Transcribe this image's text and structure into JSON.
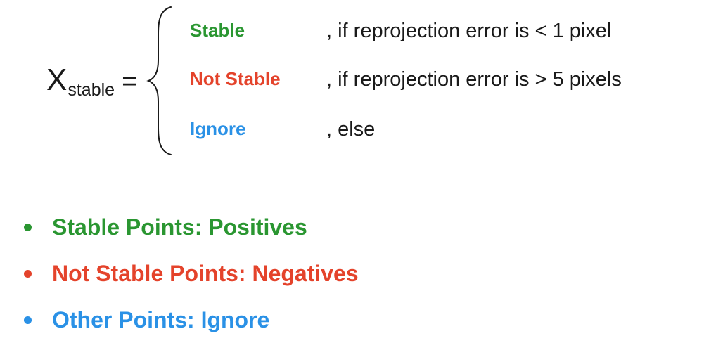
{
  "equation": {
    "variable": "X",
    "subscript": "stable",
    "equals": "=",
    "cases": [
      {
        "label": "Stable",
        "condition": ", if reprojection error is < 1 pixel",
        "color": "#2a9631"
      },
      {
        "label": "Not Stable",
        "condition": ", if reprojection error is > 5 pixels",
        "color": "#e4432b"
      },
      {
        "label": "Ignore",
        "condition": ", else",
        "color": "#2a91e6"
      }
    ]
  },
  "bullets": [
    {
      "text": "Stable Points: Positives",
      "color": "#2a9631"
    },
    {
      "text": "Not Stable Points: Negatives",
      "color": "#e4432b"
    },
    {
      "text": "Other Points: Ignore",
      "color": "#2a91e6"
    }
  ]
}
